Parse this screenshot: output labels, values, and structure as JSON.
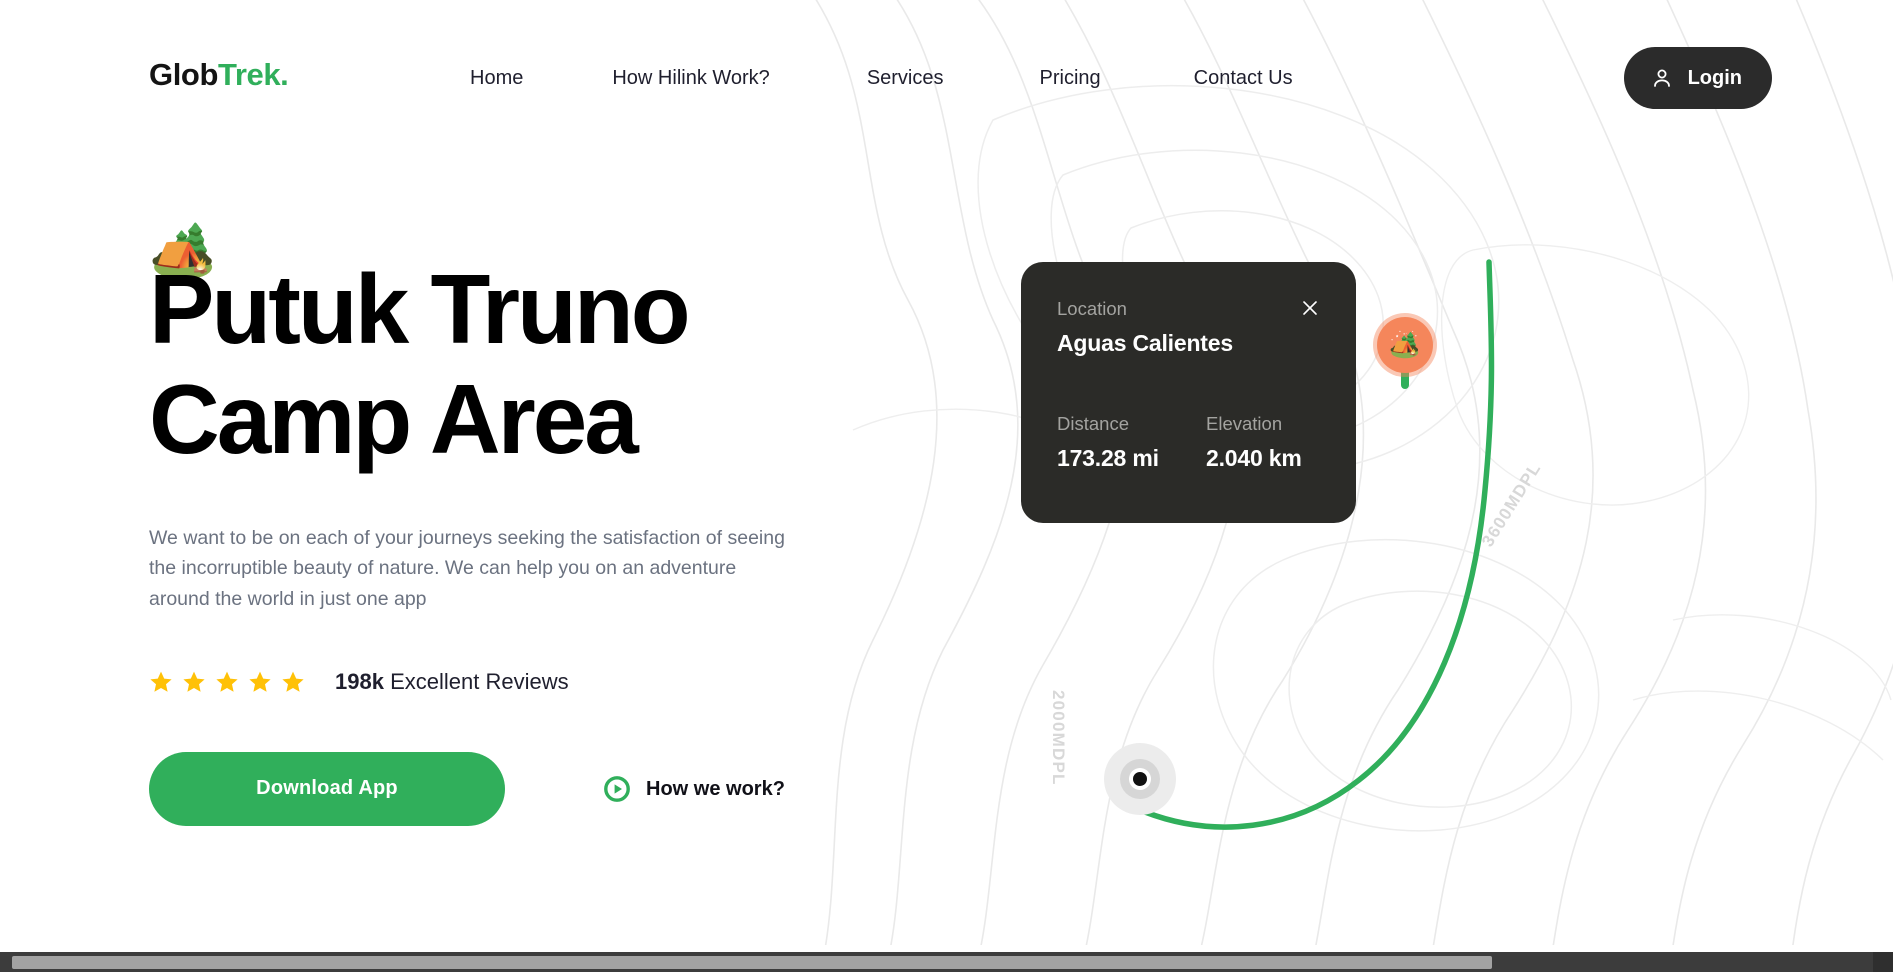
{
  "brand": {
    "name_dark": "Glob",
    "name_accent": "Trek.",
    "accent_color": "#30af5b",
    "dark_color": "#141414"
  },
  "nav": {
    "items": [
      {
        "label": "Home"
      },
      {
        "label": "How Hilink Work?"
      },
      {
        "label": "Services"
      },
      {
        "label": "Pricing"
      },
      {
        "label": "Contact Us"
      }
    ]
  },
  "login": {
    "label": "Login",
    "icon": "user-icon",
    "background": "#2b2b2b"
  },
  "hero": {
    "badge_icon": "camping-tent-emoji",
    "badge_glyph": "🏕️",
    "title": "Putuk Truno Camp Area",
    "title_line_1": "Putuk Truno",
    "title_line_2": "Camp Area",
    "description": "We want to be on each of your journeys seeking the satisfaction of seeing the incorruptible beauty of nature. We can help you on an adventure around the world in just one app",
    "rating": {
      "stars": 5,
      "star_color": "#ffc107",
      "count": "198k",
      "label": "Excellent Reviews"
    },
    "primary_button": {
      "label": "Download App",
      "background": "#30af5b"
    },
    "secondary_button": {
      "label": "How we work?",
      "icon": "play-circle-icon",
      "icon_color": "#30af5b"
    }
  },
  "info_card": {
    "background": "#2b2b28",
    "close_icon": "close-icon",
    "location_key": "Location",
    "location_value": "Aguas Calientes",
    "stats": [
      {
        "key": "Distance",
        "value": "173.28 mi"
      },
      {
        "key": "Elevation",
        "value": "2.040 km"
      }
    ]
  },
  "map": {
    "camp_pin": {
      "icon": "camping-tent-emoji",
      "glyph": "🏕️",
      "color": "#f5865b"
    },
    "start_marker": {
      "icon": "location-dot-icon"
    },
    "route_color": "#30af5b",
    "contour_labels": [
      {
        "text": "3600MDPL"
      },
      {
        "text": "2000MDPL"
      }
    ]
  }
}
